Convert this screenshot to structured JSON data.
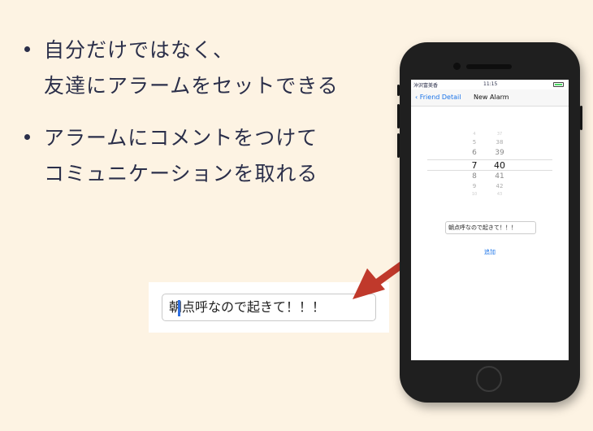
{
  "bullets": [
    {
      "lines": [
        "自分だけではなく、",
        "友達にアラームをセットできる"
      ]
    },
    {
      "lines": [
        "アラームにコメントをつけて",
        "コミュニケーションを取れる"
      ]
    }
  ],
  "zoom": {
    "field_text": "朝点呼なので起きて！！！"
  },
  "phone": {
    "status": {
      "carrier": "沖沢富美香",
      "time": "11:15"
    },
    "nav": {
      "back_label": "Friend Detail",
      "title": "New Alarm"
    },
    "picker": {
      "hours": [
        "4",
        "5",
        "6",
        "7",
        "8",
        "9",
        "10"
      ],
      "minutes": [
        "37",
        "38",
        "39",
        "40",
        "41",
        "42",
        "43"
      ],
      "selected_hour": "7",
      "selected_minute": "40"
    },
    "comment_field": "朝点呼なので起きて！！！",
    "add_button": "追加"
  },
  "colors": {
    "background": "#fdf3e3",
    "arrow": "#c0392b",
    "accent": "#1a73e8"
  }
}
